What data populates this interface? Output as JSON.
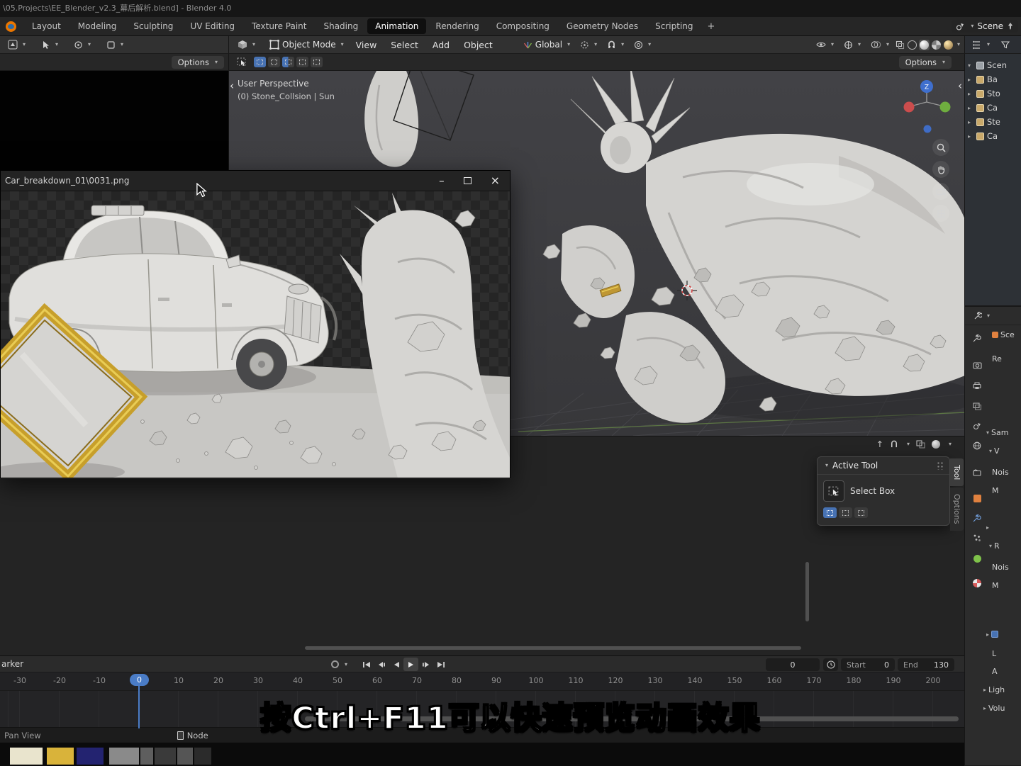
{
  "window": {
    "title": "\\05.Projects\\EE_Blender_v2.3_幕后解析.blend] - Blender 4.0"
  },
  "icons": {
    "caret": "▾",
    "disclosure": "▸",
    "expanded": "▾",
    "collapse": "‹",
    "minimize": "–",
    "close": "×",
    "plus": "+",
    "arrow_up": "↑",
    "axis_z": "Z"
  },
  "topbar": {
    "tabs": [
      "Layout",
      "Modeling",
      "Sculpting",
      "UV Editing",
      "Texture Paint",
      "Shading",
      "Animation",
      "Rendering",
      "Compositing",
      "Geometry Nodes",
      "Scripting"
    ],
    "active_tab": "Animation",
    "scene": "Scene"
  },
  "header": {
    "mode": "Object Mode",
    "menu_view": "View",
    "menu_select": "Select",
    "menu_add": "Add",
    "menu_object": "Object",
    "orientation": "Global",
    "options": "Options"
  },
  "viewport": {
    "perspective": "User Perspective",
    "annotation": "(0) Stone_Collsion | Sun"
  },
  "image_window": {
    "title": "Car_breakdown_01\\0031.png"
  },
  "outliner": {
    "root": "Scen",
    "items": [
      "Ba",
      "Sto",
      "Ca",
      "Ste",
      "Ca"
    ]
  },
  "properties": {
    "fragments": [
      "Sce",
      "Re",
      "Sam",
      "V",
      "Nois",
      "M",
      "R",
      "Nois",
      "M",
      "L",
      "A",
      "Ligh",
      "Volu"
    ]
  },
  "active_tool": {
    "title": "Active Tool",
    "tool": "Select Box",
    "tab_tool": "Tool",
    "tab_options": "Options"
  },
  "timeline": {
    "marker_menu": "arker",
    "frame": "0",
    "playhead": "0",
    "start_label": "Start",
    "start_value": "0",
    "end_label": "End",
    "end_value": "130",
    "ticks": [
      "-30",
      "-20",
      "-10",
      "0",
      "10",
      "20",
      "30",
      "40",
      "50",
      "60",
      "70",
      "80",
      "90",
      "100",
      "110",
      "120",
      "130",
      "140",
      "150",
      "160",
      "170",
      "180",
      "190",
      "200"
    ]
  },
  "status": {
    "left": "Pan View",
    "track": "Node"
  },
  "subtitle": {
    "text": "按Ctrl+F11可以快速预览动画效果"
  },
  "colors": {
    "accent": "#4772b3",
    "playhead": "#4a7cc7",
    "gold": "#c9a227",
    "viewport_bg": "#3c3c3f"
  }
}
